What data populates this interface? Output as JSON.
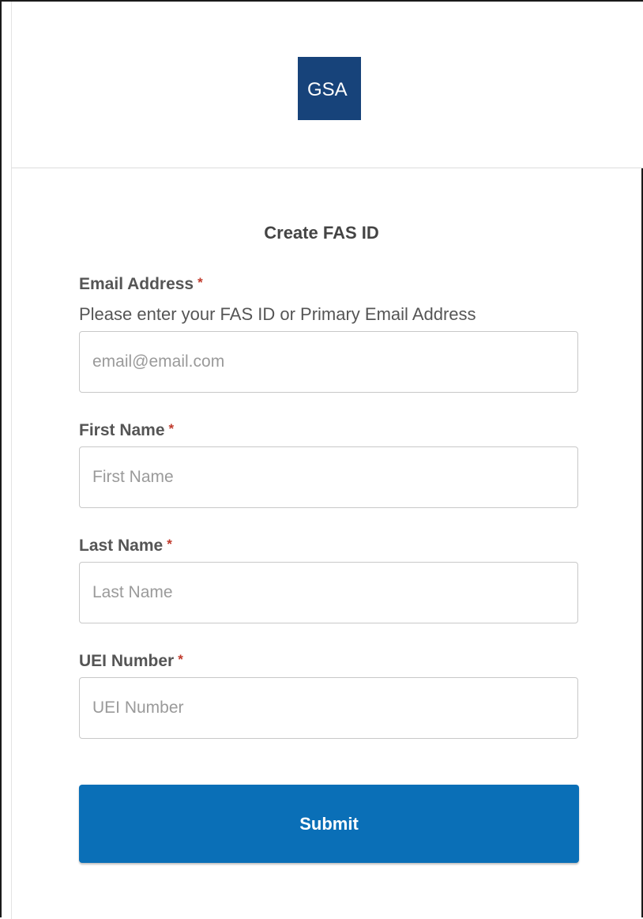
{
  "header": {
    "logo_text": "GSA",
    "logo_color": "#17437a"
  },
  "form": {
    "title": "Create FAS ID",
    "required_marker": "*",
    "email": {
      "label": "Email Address",
      "help": "Please enter your FAS ID or Primary Email Address",
      "placeholder": "email@email.com",
      "value": ""
    },
    "first_name": {
      "label": "First Name",
      "placeholder": "First Name",
      "value": ""
    },
    "last_name": {
      "label": "Last Name",
      "placeholder": "Last Name",
      "value": ""
    },
    "uei_number": {
      "label": "UEI Number",
      "placeholder": "UEI Number",
      "value": ""
    },
    "submit_label": "Submit",
    "submit_color": "#0a6fb7"
  }
}
